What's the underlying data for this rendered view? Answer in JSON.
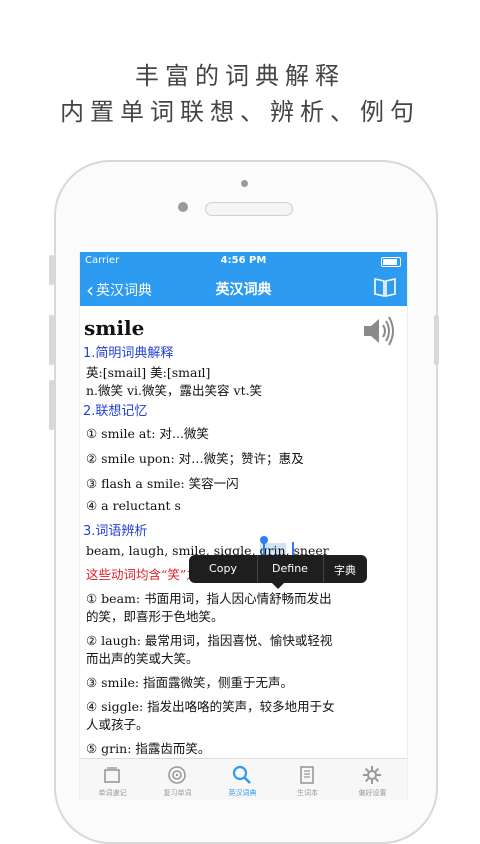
{
  "promo": {
    "line1": "丰富的词典解释",
    "line2": "内置单词联想、辨析、例句"
  },
  "status_bar": {
    "carrier": "Carrier",
    "time": "4:56 PM"
  },
  "nav": {
    "back_label": "英汉词典",
    "title": "英汉词典",
    "book_icon": "book-icon"
  },
  "entry": {
    "word": "smile",
    "sections": [
      {
        "title": "1.简明词典解释"
      },
      {
        "title": "2.联想记忆"
      },
      {
        "title": "3.词语辨析"
      }
    ],
    "phonetic": "英:[smail] 美:[smaɪl]",
    "definition": "n.微笑 vi.微笑，露出笑容 vt.笑",
    "associations": [
      "① smile at: 对...微笑",
      "② smile upon: 对…微笑；赞许；惠及",
      "③ flash a smile: 笑容一闪",
      "④ a reluctant s"
    ],
    "synonyms_pre": "beam, laugh, smile, siggle, ",
    "synonyms_selected": "grin",
    "synonyms_post": ", sneer",
    "note": "这些动词均含“笑”之意。",
    "distinctions": [
      "① beam: 书面用词，指人因心情舒畅而发出",
      "的笑，即喜形于色地笑。",
      "② laugh: 最常用词，指因喜悦、愉快或轻视",
      "而出声的笑或大笑。",
      "③ smile: 指面露微笑，侧重于无声。",
      "④ siggle: 指发出咯咯的笑声，较多地用于女",
      "人或孩子。",
      "⑤ grin: 指露齿而笑。"
    ]
  },
  "context_menu": {
    "items": [
      "Copy",
      "Define",
      "字典"
    ]
  },
  "tabs": [
    {
      "label": "单词速记",
      "icon": "cards-icon",
      "active": false
    },
    {
      "label": "复习单词",
      "icon": "target-icon",
      "active": false
    },
    {
      "label": "英汉词典",
      "icon": "search-icon",
      "active": true
    },
    {
      "label": "生词本",
      "icon": "notebook-icon",
      "active": false
    },
    {
      "label": "偏好设置",
      "icon": "gear-icon",
      "active": false
    }
  ],
  "colors": {
    "accent": "#2d9bf0",
    "section": "#2340d8",
    "note": "#e0202a"
  }
}
